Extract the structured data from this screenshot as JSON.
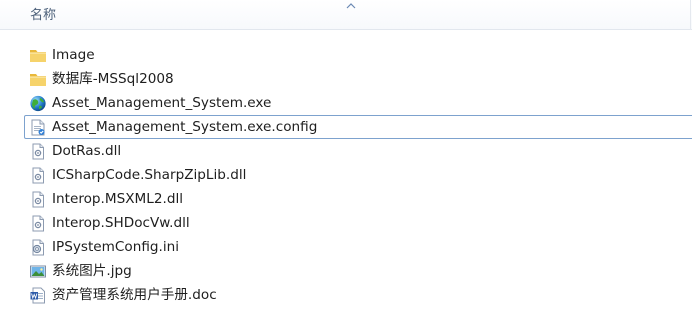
{
  "header": {
    "name_column": "名称"
  },
  "files": [
    {
      "name": "Image",
      "icon": "folder-icon",
      "selected": false
    },
    {
      "name": "数据库-MSSql2008",
      "icon": "folder-icon",
      "selected": false
    },
    {
      "name": "Asset_Management_System.exe",
      "icon": "globe-app-icon",
      "selected": false
    },
    {
      "name": "Asset_Management_System.exe.config",
      "icon": "config-file-icon",
      "selected": true
    },
    {
      "name": "DotRas.dll",
      "icon": "dll-file-icon",
      "selected": false
    },
    {
      "name": "ICSharpCode.SharpZipLib.dll",
      "icon": "dll-file-icon",
      "selected": false
    },
    {
      "name": "Interop.MSXML2.dll",
      "icon": "dll-file-icon",
      "selected": false
    },
    {
      "name": "Interop.SHDocVw.dll",
      "icon": "dll-file-icon",
      "selected": false
    },
    {
      "name": "IPSystemConfig.ini",
      "icon": "ini-file-icon",
      "selected": false
    },
    {
      "name": "系统图片.jpg",
      "icon": "image-file-icon",
      "selected": false
    },
    {
      "name": "资产管理系统用户手册.doc",
      "icon": "word-doc-icon",
      "selected": false
    }
  ],
  "colors": {
    "selection_border": "#7da2ce",
    "header_text": "#4c607a",
    "folder_yellow": "#f2c94c"
  }
}
